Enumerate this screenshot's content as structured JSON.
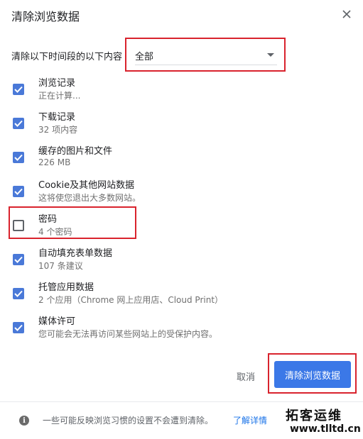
{
  "dialog": {
    "title": "清除浏览数据",
    "range_label": "清除以下时间段的以下内容",
    "range_value": "全部"
  },
  "items": [
    {
      "title": "浏览记录",
      "sub": "正在计算...",
      "checked": true
    },
    {
      "title": "下载记录",
      "sub": "32 项内容",
      "checked": true
    },
    {
      "title": "缓存的图片和文件",
      "sub": "226 MB",
      "checked": true
    },
    {
      "title": "Cookie及其他网站数据",
      "sub": "这将使您退出大多数网站。",
      "checked": true
    },
    {
      "title": "密码",
      "sub": "4 个密码",
      "checked": false
    },
    {
      "title": "自动填充表单数据",
      "sub": "107 条建议",
      "checked": true
    },
    {
      "title": "托管应用数据",
      "sub": "2 个应用（Chrome 网上应用店、Cloud Print）",
      "checked": true
    },
    {
      "title": "媒体许可",
      "sub": "您可能会无法再访问某些网站上的受保护内容。",
      "checked": true
    }
  ],
  "buttons": {
    "cancel": "取消",
    "clear": "清除浏览数据"
  },
  "footer": {
    "note": "一些可能反映浏览习惯的设置不会遭到清除。",
    "link": "了解详情"
  },
  "watermark": {
    "line1": "拓客运维",
    "line2": "www.tlltd.cn"
  },
  "colors": {
    "accent": "#3b78e7",
    "checkbox": "#4a79d8",
    "highlight": "#d9232d"
  }
}
